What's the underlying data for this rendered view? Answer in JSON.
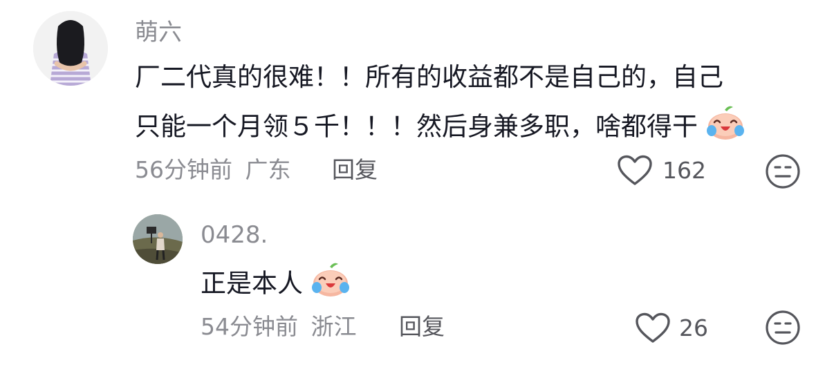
{
  "comments": [
    {
      "username": "萌六",
      "text_line1": "厂二代真的很难！！所有的收益都不是自己的，自己",
      "text_line2": "只能一个月领５千！！！然后身兼多职，啥都得干",
      "emoji": "crying-laugh-peach-emoji",
      "time": "56分钟前",
      "location": "广东",
      "reply_label": "回复",
      "likes": "162"
    }
  ],
  "replies": [
    {
      "username": "0428.",
      "text": "正是本人",
      "emoji": "crying-laugh-peach-emoji",
      "time": "54分钟前",
      "location": "浙江",
      "reply_label": "回复",
      "likes": "26"
    }
  ],
  "icons": {
    "like": "heart-outline-icon",
    "dislike": "meh-face-icon"
  },
  "colors": {
    "text": "#161823",
    "secondary": "#8a8b91",
    "action": "#55565c"
  }
}
